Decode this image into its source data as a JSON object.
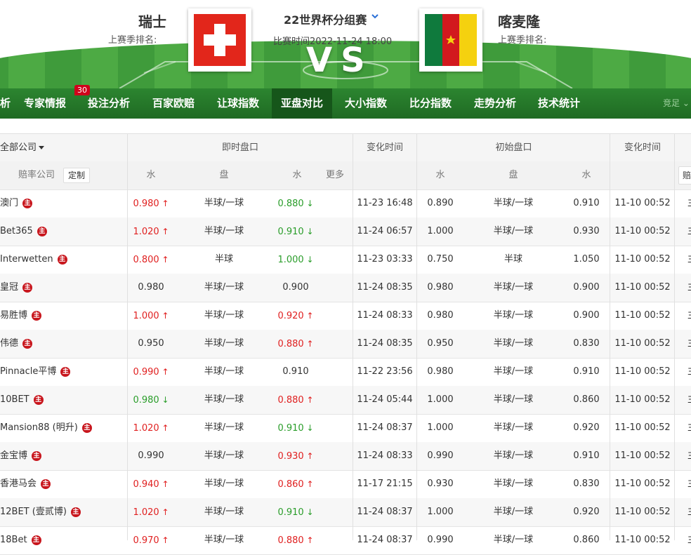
{
  "header": {
    "home_team": "瑞士",
    "away_team": "喀麦隆",
    "home_rank_label": "上赛季排名:",
    "away_rank_label": "上赛季排名:",
    "league": "22世界杯分组赛",
    "match_time": "比赛时间2022-11-24 18:00",
    "vs": "VS"
  },
  "nav": {
    "items": [
      {
        "label": "析"
      },
      {
        "label": "专家情报",
        "badge": "30"
      },
      {
        "label": "投注分析"
      },
      {
        "label": "百家欧赔"
      },
      {
        "label": "让球指数"
      },
      {
        "label": "亚盘对比",
        "active": true
      },
      {
        "label": "大小指数"
      },
      {
        "label": "比分指数"
      },
      {
        "label": "走势分析"
      },
      {
        "label": "技术统计"
      }
    ],
    "right_label": "竞足 "
  },
  "table": {
    "header1": {
      "all_companies": "全部公司",
      "live": "即时盘口",
      "change_time": "变化时间",
      "initial": "初始盘口",
      "change_time2": "变化时间"
    },
    "header2": {
      "company": "赔率公司",
      "custom": "定制",
      "water1": "水",
      "handicap": "盘",
      "water2": "水",
      "more": "更多",
      "iwater1": "水",
      "ihandicap": "盘",
      "iwater2": "水",
      "right_box": "赔"
    },
    "zhu_label": "主",
    "col_tail": "主",
    "rows": [
      {
        "company": "澳门",
        "w1": "0.980",
        "w1d": "up",
        "pan": "半球/一球",
        "w2": "0.880",
        "w2d": "down",
        "time": "11-23 16:48",
        "iw1": "0.890",
        "ipan": "半球/一球",
        "iw2": "0.910",
        "itime": "11-10 00:52"
      },
      {
        "company": "Bet365",
        "w1": "1.020",
        "w1d": "up",
        "pan": "半球/一球",
        "w2": "0.910",
        "w2d": "down",
        "time": "11-24 06:57",
        "iw1": "1.000",
        "ipan": "半球/一球",
        "iw2": "0.930",
        "itime": "11-10 00:52"
      },
      {
        "company": "Interwetten",
        "w1": "0.800",
        "w1d": "up",
        "pan": "半球",
        "w2": "1.000",
        "w2d": "down",
        "time": "11-23 03:33",
        "iw1": "0.750",
        "ipan": "半球",
        "iw2": "1.050",
        "itime": "11-10 00:52"
      },
      {
        "company": "皇冠",
        "w1": "0.980",
        "w1d": "",
        "pan": "半球/一球",
        "w2": "0.900",
        "w2d": "",
        "time": "11-24 08:35",
        "iw1": "0.980",
        "ipan": "半球/一球",
        "iw2": "0.900",
        "itime": "11-10 00:52"
      },
      {
        "company": "易胜博",
        "w1": "1.000",
        "w1d": "up",
        "pan": "半球/一球",
        "w2": "0.920",
        "w2d": "up",
        "time": "11-24 08:33",
        "iw1": "0.980",
        "ipan": "半球/一球",
        "iw2": "0.900",
        "itime": "11-10 00:52"
      },
      {
        "company": "伟德",
        "w1": "0.950",
        "w1d": "",
        "pan": "半球/一球",
        "w2": "0.880",
        "w2d": "up",
        "time": "11-24 08:35",
        "iw1": "0.950",
        "ipan": "半球/一球",
        "iw2": "0.830",
        "itime": "11-10 00:52"
      },
      {
        "company": "Pinnacle平博",
        "w1": "0.990",
        "w1d": "up",
        "pan": "半球/一球",
        "w2": "0.910",
        "w2d": "",
        "time": "11-22 23:56",
        "iw1": "0.980",
        "ipan": "半球/一球",
        "iw2": "0.910",
        "itime": "11-10 00:52"
      },
      {
        "company": "10BET",
        "w1": "0.980",
        "w1d": "down",
        "pan": "半球/一球",
        "w2": "0.880",
        "w2d": "up",
        "time": "11-24 05:44",
        "iw1": "1.000",
        "ipan": "半球/一球",
        "iw2": "0.860",
        "itime": "11-10 00:52"
      },
      {
        "company": "Mansion88 (明升)",
        "w1": "1.020",
        "w1d": "up",
        "pan": "半球/一球",
        "w2": "0.910",
        "w2d": "down",
        "time": "11-24 08:37",
        "iw1": "1.000",
        "ipan": "半球/一球",
        "iw2": "0.920",
        "itime": "11-10 00:52"
      },
      {
        "company": "金宝博",
        "w1": "0.990",
        "w1d": "",
        "pan": "半球/一球",
        "w2": "0.930",
        "w2d": "up",
        "time": "11-24 08:33",
        "iw1": "0.990",
        "ipan": "半球/一球",
        "iw2": "0.910",
        "itime": "11-10 00:52"
      },
      {
        "company": "香港马会",
        "w1": "0.940",
        "w1d": "up",
        "pan": "半球/一球",
        "w2": "0.860",
        "w2d": "up",
        "time": "11-17 21:15",
        "iw1": "0.930",
        "ipan": "半球/一球",
        "iw2": "0.830",
        "itime": "11-10 00:52"
      },
      {
        "company": "12BET (壹贰博)",
        "w1": "1.020",
        "w1d": "up",
        "pan": "半球/一球",
        "w2": "0.910",
        "w2d": "down",
        "time": "11-24 08:37",
        "iw1": "1.000",
        "ipan": "半球/一球",
        "iw2": "0.920",
        "itime": "11-10 00:52"
      },
      {
        "company": "18Bet",
        "w1": "0.970",
        "w1d": "up",
        "pan": "半球/一球",
        "w2": "0.880",
        "w2d": "up",
        "time": "11-24 08:37",
        "iw1": "0.990",
        "ipan": "半球/一球",
        "iw2": "0.860",
        "itime": "11-10 00:52"
      }
    ]
  },
  "colors": {
    "up": "#e02020",
    "down": "#2a9d2a",
    "nav_bg": "#287a2b",
    "nav_active": "#16561a",
    "badge": "#d0021b"
  }
}
